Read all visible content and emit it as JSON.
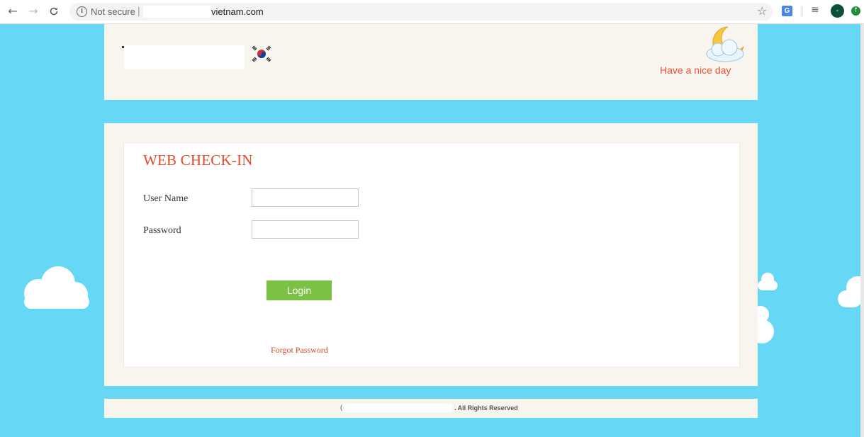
{
  "browser": {
    "nav": {
      "back_icon": "←",
      "forward_icon": "→",
      "reload_icon": "C"
    },
    "security_label": "Not secure",
    "url_separator": "|",
    "url_domain": "vietnam.com",
    "star_icon": "☆",
    "translate_icon": "G",
    "queue_icon": "≡",
    "avatar_letter": "-",
    "extension_icon": "↑"
  },
  "header": {
    "greeting": "Have a nice day"
  },
  "login": {
    "title": "WEB CHECK-IN",
    "username_label": "User Name",
    "username_value": "",
    "password_label": "Password",
    "password_value": "",
    "button_label": "Login",
    "forgot_link": "Forgot Password"
  },
  "footer": {
    "copyright_prefix": "(",
    "rights_text": ". All Rights Reserved"
  },
  "colors": {
    "page_background": "#66d8f5",
    "panel_background": "#f7f5ed",
    "accent_red": "#e24b2a",
    "button_green": "#7bc144"
  }
}
